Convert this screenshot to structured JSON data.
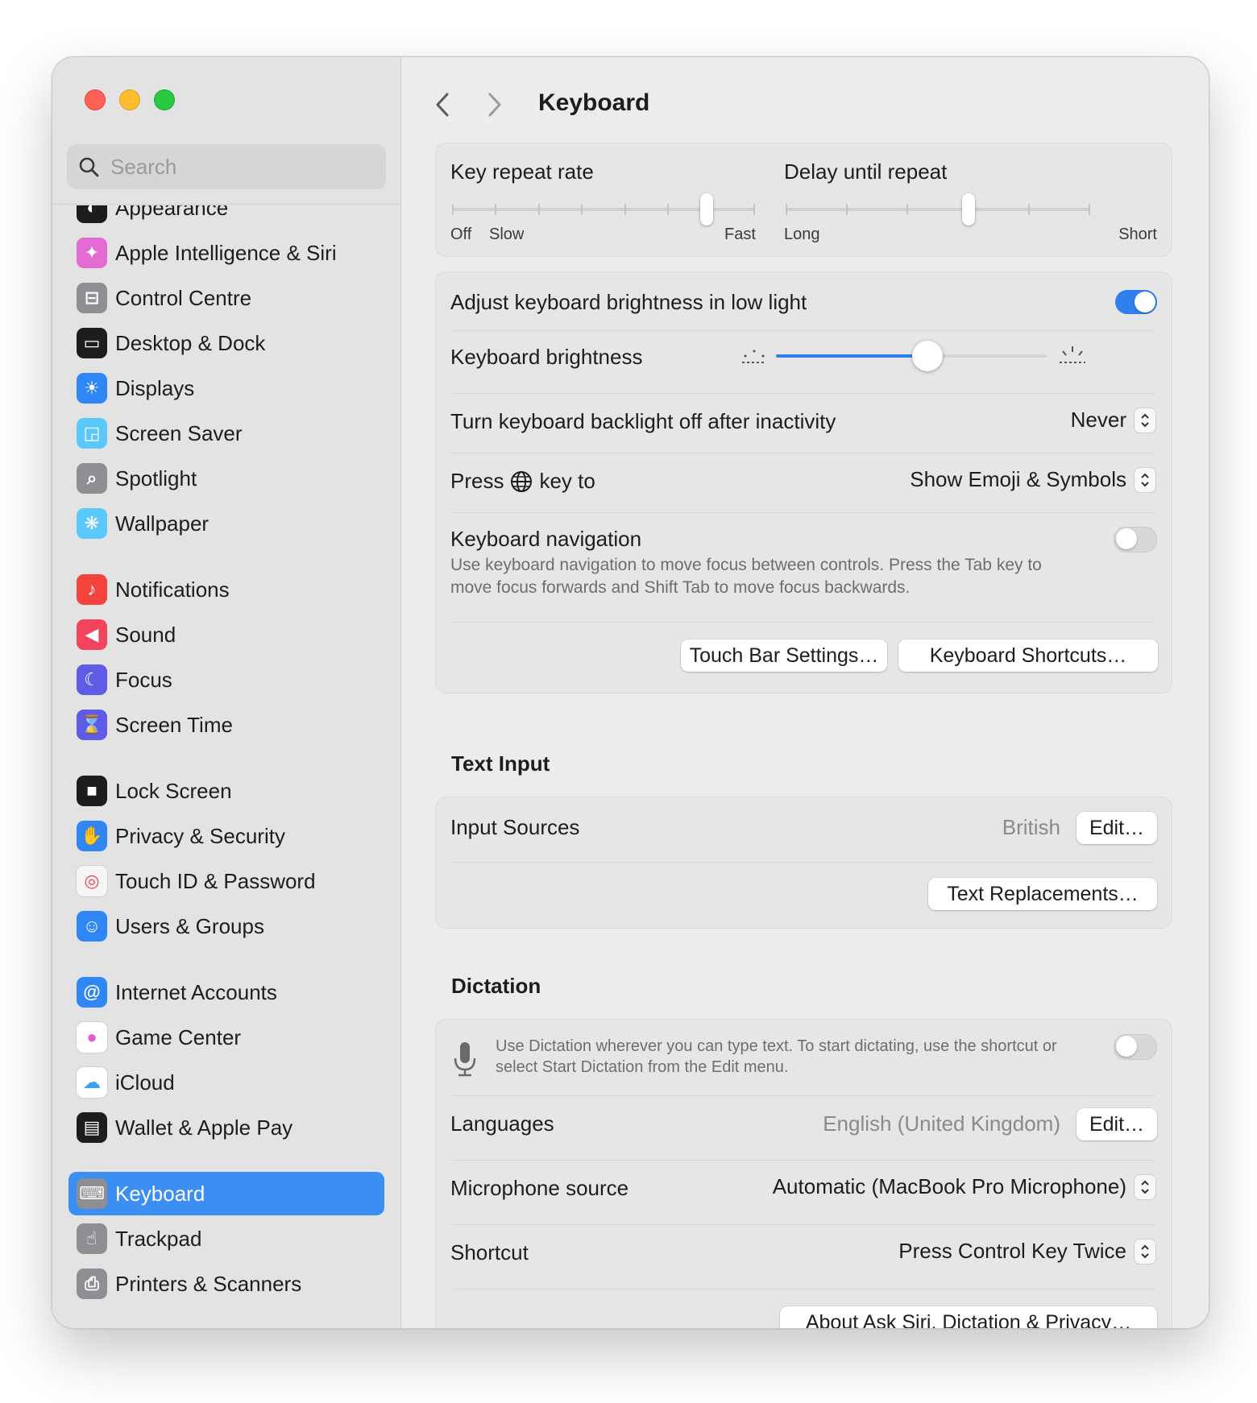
{
  "window": {
    "title": "Keyboard"
  },
  "search": {
    "placeholder": "Search"
  },
  "sidebar": {
    "items": [
      {
        "label": "Appearance",
        "icon": "appearance-icon",
        "color": "#1d1d1f"
      },
      {
        "label": "Apple Intelligence & Siri",
        "icon": "siri-icon",
        "color": "#e36bd3"
      },
      {
        "label": "Control Centre",
        "icon": "control-centre-icon",
        "color": "#8e8e93"
      },
      {
        "label": "Desktop & Dock",
        "icon": "desktop-dock-icon",
        "color": "#1d1d1f"
      },
      {
        "label": "Displays",
        "icon": "displays-icon",
        "color": "#2f86f5"
      },
      {
        "label": "Screen Saver",
        "icon": "screen-saver-icon",
        "color": "#5ac8fa"
      },
      {
        "label": "Spotlight",
        "icon": "spotlight-icon",
        "color": "#8e8e93"
      },
      {
        "label": "Wallpaper",
        "icon": "wallpaper-icon",
        "color": "#5ac8fa"
      },
      {
        "label": "Notifications",
        "icon": "notifications-icon",
        "color": "#f2443d"
      },
      {
        "label": "Sound",
        "icon": "sound-icon",
        "color": "#f2445c"
      },
      {
        "label": "Focus",
        "icon": "focus-icon",
        "color": "#5e5ce6"
      },
      {
        "label": "Screen Time",
        "icon": "screen-time-icon",
        "color": "#5e5ce6"
      },
      {
        "label": "Lock Screen",
        "icon": "lock-screen-icon",
        "color": "#1d1d1f"
      },
      {
        "label": "Privacy & Security",
        "icon": "privacy-hand-icon",
        "color": "#2f86f5"
      },
      {
        "label": "Touch ID & Password",
        "icon": "fingerprint-icon",
        "color": "#f5f5f5"
      },
      {
        "label": "Users & Groups",
        "icon": "users-icon",
        "color": "#2f86f5"
      },
      {
        "label": "Internet Accounts",
        "icon": "at-sign-icon",
        "color": "#2f86f5"
      },
      {
        "label": "Game Center",
        "icon": "game-center-icon",
        "color": "#ffffff"
      },
      {
        "label": "iCloud",
        "icon": "icloud-icon",
        "color": "#ffffff"
      },
      {
        "label": "Wallet & Apple Pay",
        "icon": "wallet-icon",
        "color": "#1d1d1f"
      },
      {
        "label": "Keyboard",
        "icon": "keyboard-icon",
        "color": "#8e8e93",
        "selected": true
      },
      {
        "label": "Trackpad",
        "icon": "trackpad-icon",
        "color": "#8e8e93"
      },
      {
        "label": "Printers & Scanners",
        "icon": "printer-icon",
        "color": "#8e8e93"
      }
    ]
  },
  "repeat": {
    "rate_label": "Key repeat rate",
    "rate_min1": "Off",
    "rate_min2": "Slow",
    "rate_max": "Fast",
    "rate_value_fraction": 0.84,
    "delay_label": "Delay until repeat",
    "delay_min": "Long",
    "delay_max": "Short",
    "delay_value_fraction": 0.6
  },
  "backlight": {
    "adjust_label": "Adjust keyboard brightness in low light",
    "adjust_on": true,
    "brightness_label": "Keyboard brightness",
    "brightness_fraction": 0.56,
    "inactivity_label": "Turn keyboard backlight off after inactivity",
    "inactivity_value": "Never",
    "press_prefix": "Press",
    "press_suffix": "key to",
    "globe_value": "Show Emoji & Symbols",
    "nav_label": "Keyboard navigation",
    "nav_desc": "Use keyboard navigation to move focus between controls. Press the Tab key to move focus forwards and Shift Tab to move focus backwards.",
    "nav_on": false,
    "touchbar_btn": "Touch Bar Settings…",
    "shortcuts_btn": "Keyboard Shortcuts…"
  },
  "text_input": {
    "title": "Text Input",
    "sources_label": "Input Sources",
    "sources_value": "British",
    "edit_btn": "Edit…",
    "replacements_btn": "Text Replacements…"
  },
  "dictation": {
    "title": "Dictation",
    "desc": "Use Dictation wherever you can type text. To start dictating, use the shortcut or select Start Dictation from the Edit menu.",
    "on": false,
    "languages_label": "Languages",
    "languages_value": "English (United Kingdom)",
    "edit_btn": "Edit…",
    "mic_label": "Microphone source",
    "mic_value": "Automatic (MacBook Pro Microphone)",
    "shortcut_label": "Shortcut",
    "shortcut_value": "Press Control Key Twice",
    "about_btn": "About Ask Siri, Dictation & Privacy…"
  },
  "colors": {
    "accent": "#2f80ed",
    "selected_row": "#3b8ef2"
  }
}
